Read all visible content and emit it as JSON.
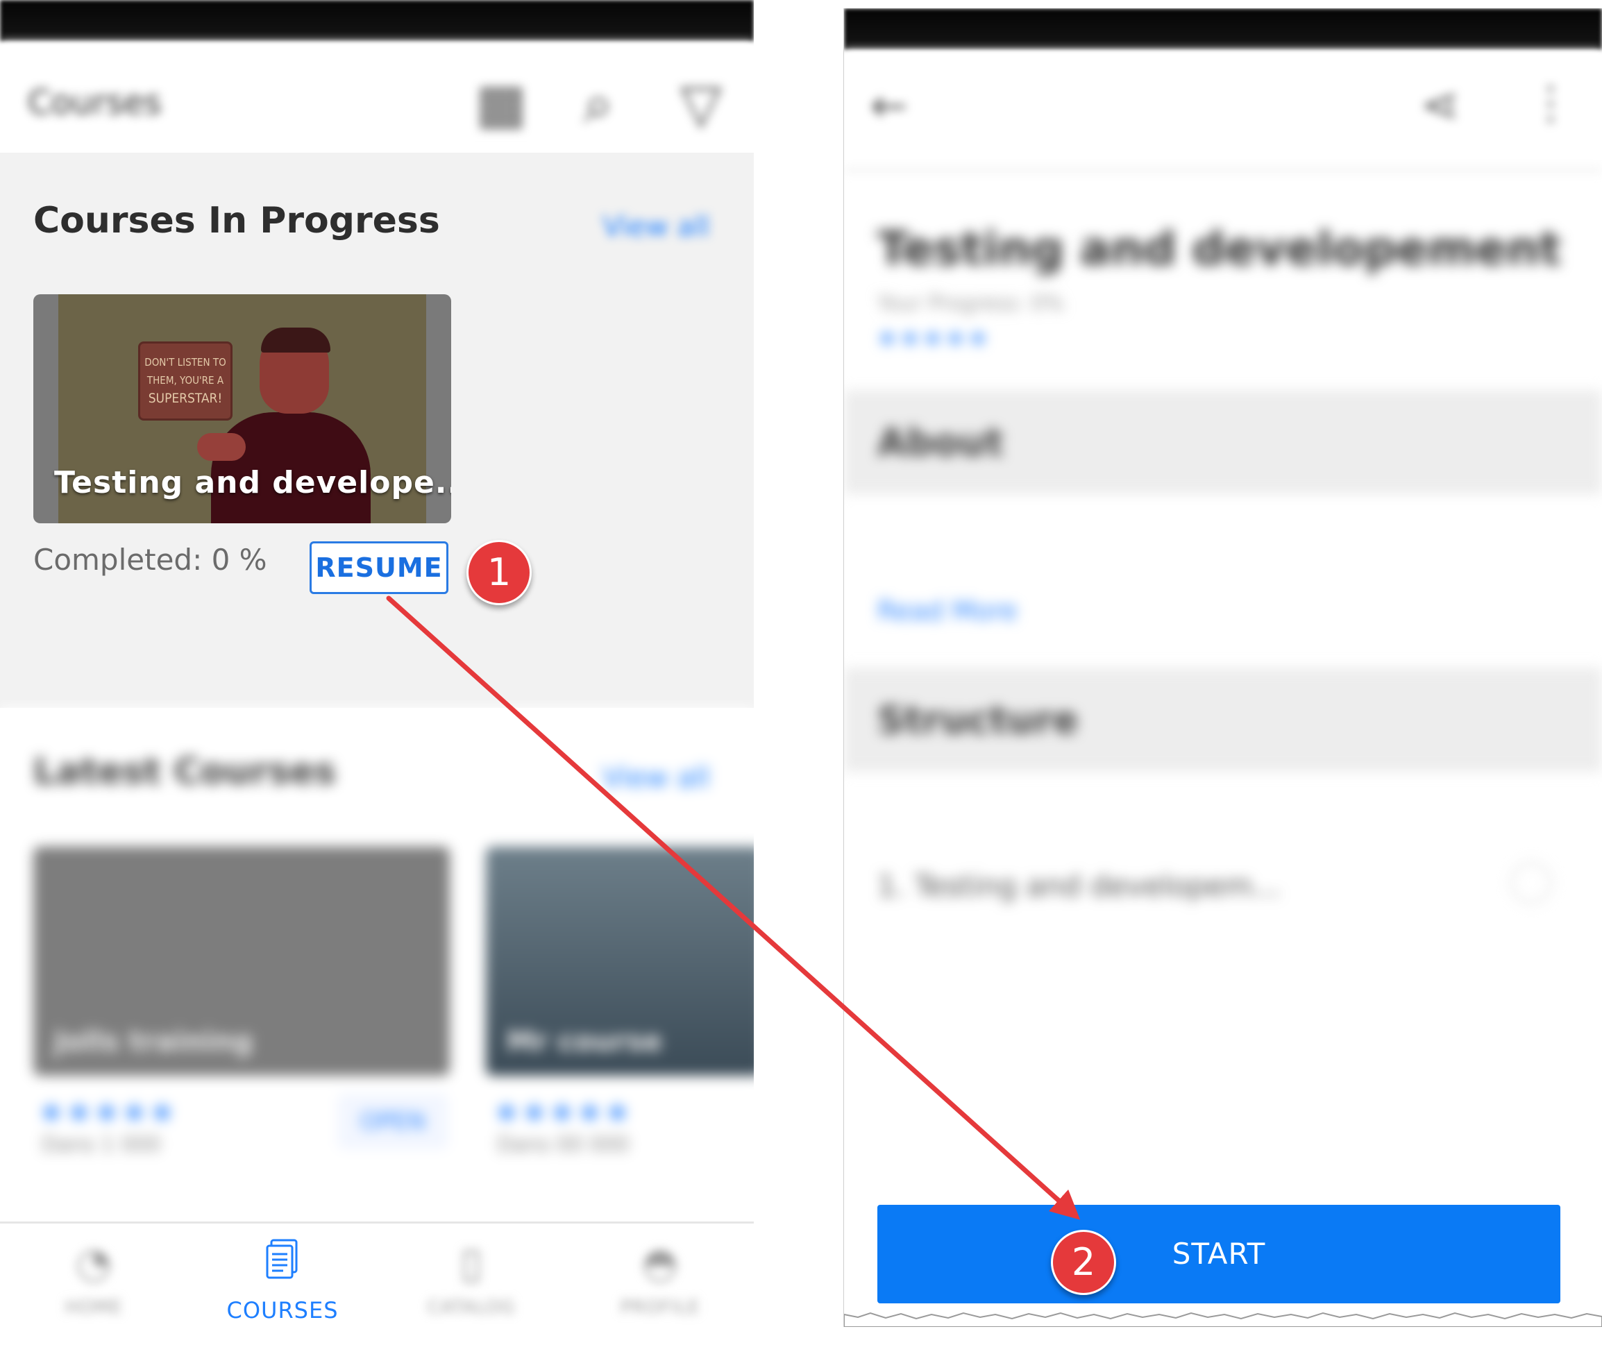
{
  "left_screen": {
    "appbar": {
      "title": "Courses"
    },
    "in_progress": {
      "title": "Courses In Progress",
      "view_all": "View all",
      "course": {
        "title": "Testing  and develope...",
        "thumbnail_text": "DON'T LISTEN TO THEM, YOU'RE A SUPERSTAR!",
        "completed": "Completed: 0 %",
        "resume_label": "RESUME"
      }
    },
    "latest": {
      "title": "Latest Courses",
      "view_all": "View all",
      "cards": [
        {
          "title": "Jolls training",
          "stars": "★★★★★",
          "meta": "Dans 1 000"
        },
        {
          "title": "Mr course",
          "stars": "★★★★★",
          "meta": "Dans 00 000"
        }
      ],
      "open_label": "OPEN"
    },
    "bottom_nav": [
      {
        "label": "HOME",
        "icon": "home-icon",
        "active": false
      },
      {
        "label": "COURSES",
        "icon": "document-icon",
        "active": true
      },
      {
        "label": "CATALOG",
        "icon": "catalog-icon",
        "active": false
      },
      {
        "label": "PROFILE",
        "icon": "profile-icon",
        "active": false
      }
    ]
  },
  "right_screen": {
    "course_title": "Testing  and developement",
    "subtitle": "Your Progress: 0%",
    "stars": "★★★★★",
    "about_label": "About",
    "read_more": "Read More",
    "structure_label": "Structure",
    "structure_item": "1. Testing and developem...",
    "start_label": "START"
  },
  "annotations": {
    "step1": "1",
    "step2": "2",
    "arrow_color": "#e5393b"
  },
  "colors": {
    "accent": "#0a7af5",
    "badge": "#e5393b",
    "section_bg": "#f2f2f2"
  }
}
